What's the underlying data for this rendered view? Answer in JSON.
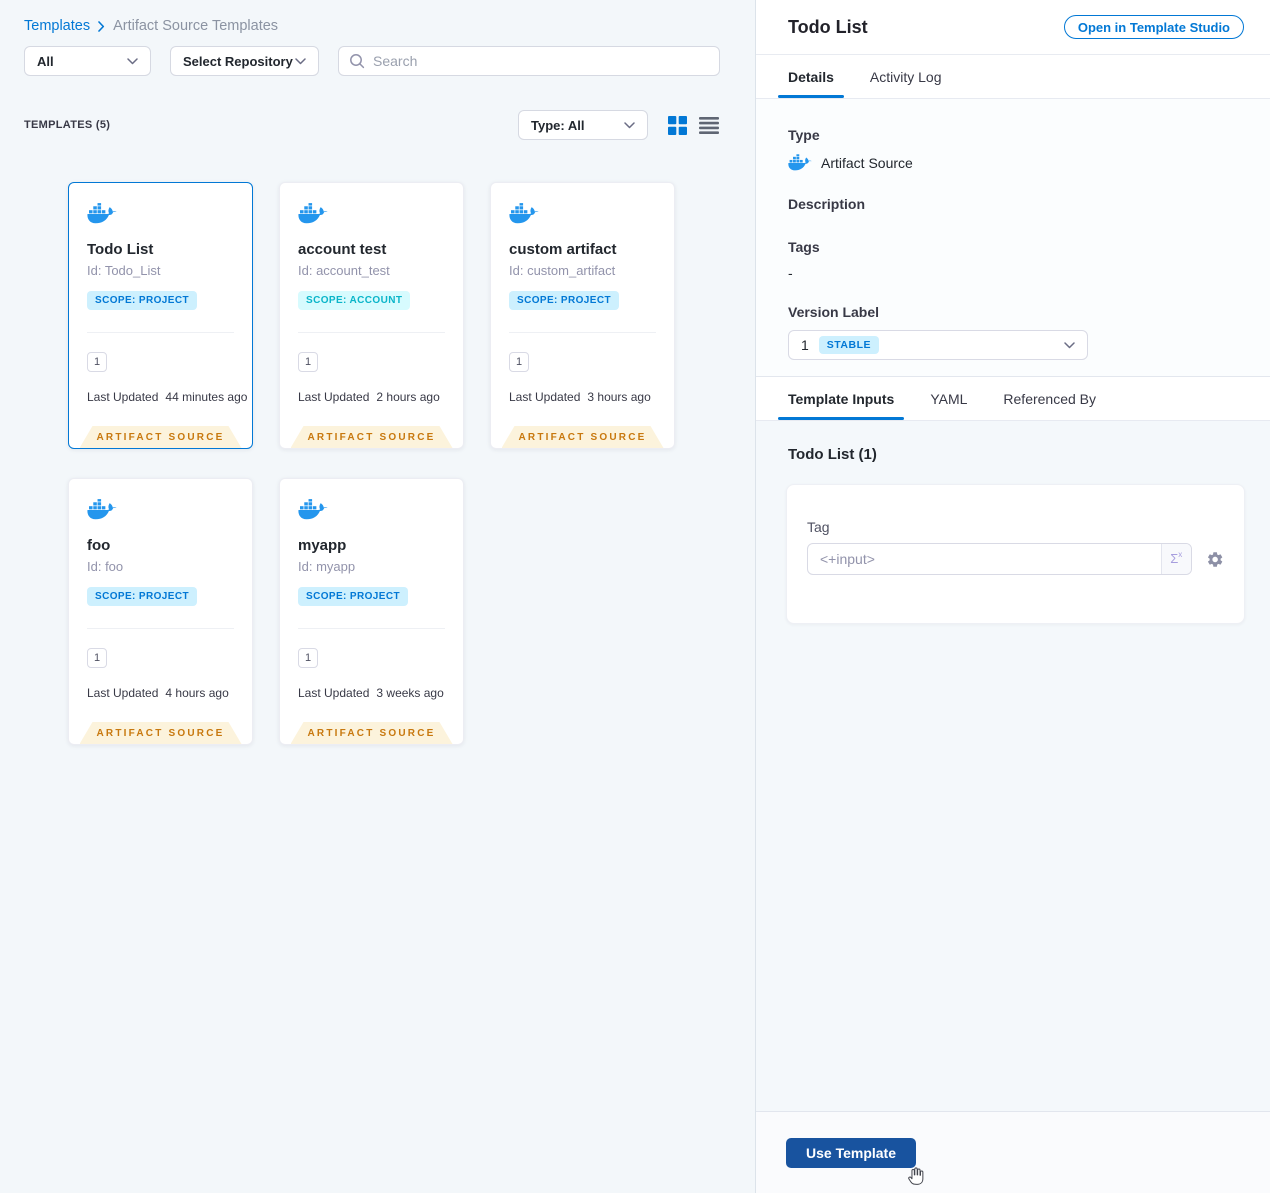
{
  "breadcrumb": {
    "root": "Templates",
    "current": "Artifact Source Templates"
  },
  "filters": {
    "scope_select": "All",
    "repo_select": "Select Repository",
    "search_placeholder": "Search"
  },
  "list_header": {
    "count": "TEMPLATES (5)",
    "type_select": "Type: All"
  },
  "cards": [
    {
      "name": "Todo List",
      "id": "Id: Todo_List",
      "scope": "SCOPE: PROJECT",
      "version": "1",
      "updated_label": "Last Updated",
      "updated": "44 minutes ago",
      "ribbon": "ARTIFACT SOURCE"
    },
    {
      "name": "account test",
      "id": "Id: account_test",
      "scope": "SCOPE: ACCOUNT",
      "version": "1",
      "updated_label": "Last Updated",
      "updated": "2 hours ago",
      "ribbon": "ARTIFACT SOURCE"
    },
    {
      "name": "custom artifact",
      "id": "Id: custom_artifact",
      "scope": "SCOPE: PROJECT",
      "version": "1",
      "updated_label": "Last Updated",
      "updated": "3 hours ago",
      "ribbon": "ARTIFACT SOURCE"
    },
    {
      "name": "foo",
      "id": "Id: foo",
      "scope": "SCOPE: PROJECT",
      "version": "1",
      "updated_label": "Last Updated",
      "updated": "4 hours ago",
      "ribbon": "ARTIFACT SOURCE"
    },
    {
      "name": "myapp",
      "id": "Id: myapp",
      "scope": "SCOPE: PROJECT",
      "version": "1",
      "updated_label": "Last Updated",
      "updated": "3 weeks ago",
      "ribbon": "ARTIFACT SOURCE"
    }
  ],
  "panel": {
    "title": "Todo List",
    "open_in_studio": "Open in Template Studio",
    "tabs": {
      "details": "Details",
      "activity_log": "Activity Log"
    },
    "details": {
      "type_label": "Type",
      "type_value": "Artifact Source",
      "description_label": "Description",
      "tags_label": "Tags",
      "tags_value": "-",
      "version_label": "Version Label",
      "version_value": "1",
      "version_badge": "STABLE"
    },
    "inputs": {
      "tabs": {
        "template_inputs": "Template Inputs",
        "yaml": "YAML",
        "referenced_by": "Referenced By"
      },
      "section_title": "Todo List (1)",
      "tag_label": "Tag",
      "tag_value": "<+input>",
      "expression_symbol": "Σ",
      "expression_sup": "x"
    },
    "footer": {
      "use_template": "Use Template"
    }
  },
  "colors": {
    "accent": "#0278d5",
    "docker_blue": "#2496ed",
    "scope_project_bg": "#cdf0fe",
    "scope_project_text": "#0278d5",
    "scope_account_bg": "#d7fbfe",
    "scope_account_text": "#0ab5c9",
    "ribbon_bg": "#fcf3dc",
    "ribbon_text": "#c8780e",
    "use_template_bg": "#18539f",
    "left_bg": "#f3f7fa",
    "inputs_bg": "#f4f8fb"
  }
}
